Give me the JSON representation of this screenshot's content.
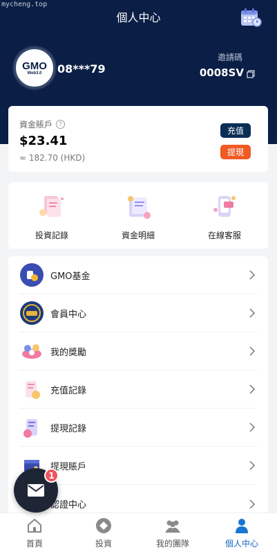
{
  "watermark": "mycheng.top",
  "header": {
    "title": "個人中心"
  },
  "profile": {
    "avatar_logo": "GMO",
    "avatar_sub": "Web3.0",
    "username": "08***79",
    "invite_label": "邀請碼",
    "invite_code": "0008SV"
  },
  "balance": {
    "label": "資金賬戶",
    "amount": "$23.41",
    "hkd": "≈ 182.70 (HKD)",
    "recharge_label": "充值",
    "withdraw_label": "提現",
    "recharge_color": "#0b2e55",
    "withdraw_color": "#f05a24"
  },
  "quick": [
    {
      "label": "投資記錄",
      "icon": "invest-record-icon"
    },
    {
      "label": "資金明細",
      "icon": "fund-detail-icon"
    },
    {
      "label": "在線客服",
      "icon": "online-service-icon"
    }
  ],
  "menu": [
    {
      "label": "GMO基金",
      "icon": "gmo-fund-icon"
    },
    {
      "label": "會員中心",
      "icon": "vip-icon"
    },
    {
      "label": "我的獎勵",
      "icon": "reward-icon"
    },
    {
      "label": "充值記錄",
      "icon": "recharge-record-icon"
    },
    {
      "label": "提現記錄",
      "icon": "withdraw-record-icon"
    },
    {
      "label": "提現賬戶",
      "icon": "withdraw-account-icon"
    },
    {
      "label": "認證中心",
      "icon": "verification-icon"
    }
  ],
  "tabs": [
    {
      "label": "首頁",
      "icon": "home-icon"
    },
    {
      "label": "投資",
      "icon": "invest-icon"
    },
    {
      "label": "我的團隊",
      "icon": "team-icon"
    },
    {
      "label": "個人中心",
      "icon": "person-icon",
      "active": true
    }
  ],
  "messages": {
    "badge": "1",
    "icon": "mail-icon"
  },
  "colors": {
    "header_bg": "#0b1e45",
    "active_tab": "#1565c0"
  }
}
